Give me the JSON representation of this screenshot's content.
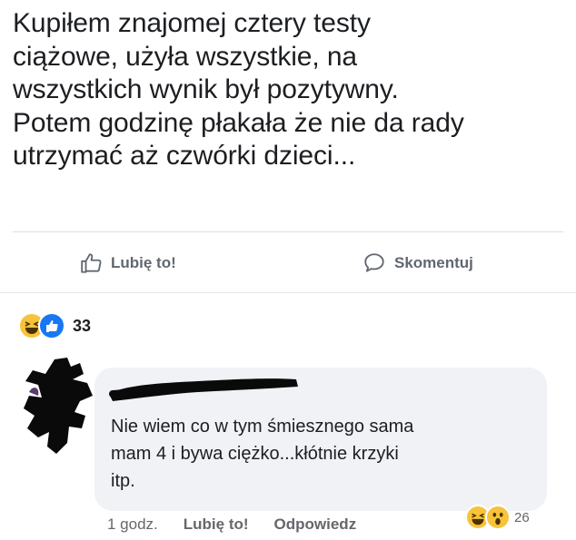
{
  "post": {
    "lines": [
      "Kupiłem znajomej cztery testy",
      "ciążowe, użyła wszystkie, na",
      "wszystkich wynik był pozytywny.",
      "Potem godzinę płakała że nie da rady",
      "utrzymać aż czwórki dzieci..."
    ]
  },
  "actions": {
    "like_label": "Lubię to!",
    "like_icon": "thumbs-up-icon",
    "comment_label": "Skomentuj",
    "comment_icon": "speech-bubble-icon"
  },
  "reactions": {
    "icons": [
      "haha-icon",
      "like-icon"
    ],
    "count": "33"
  },
  "comment": {
    "lines": [
      "Nie wiem co w tym śmiesznego sama",
      "mam 4 i bywa ciężko...kłótnie krzyki",
      "itp."
    ],
    "time": "1 godz.",
    "like_label": "Lubię to!",
    "reply_label": "Odpowiedz",
    "reactions": {
      "icons": [
        "haha-icon",
        "wow-icon"
      ],
      "count": "26"
    }
  },
  "colors": {
    "accent": "#1877f2",
    "reaction_yellow": "#f7c33b",
    "muted_text": "#65676b",
    "bubble_bg": "#f0f2f5"
  }
}
